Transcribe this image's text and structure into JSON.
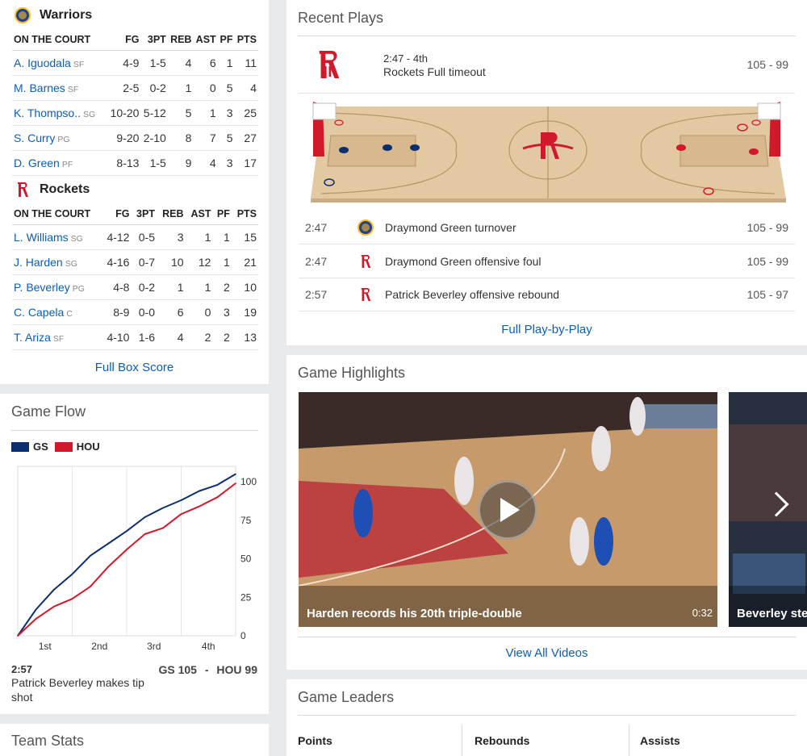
{
  "boxscore": {
    "warriors": {
      "name": "Warriors",
      "headers": [
        "ON THE COURT",
        "FG",
        "3PT",
        "REB",
        "AST",
        "PF",
        "PTS"
      ],
      "players": [
        {
          "name": "A. Iguodala",
          "pos": "SF",
          "fg": "4-9",
          "tp": "1-5",
          "reb": "4",
          "ast": "6",
          "pf": "1",
          "pts": "11"
        },
        {
          "name": "M. Barnes",
          "pos": "SF",
          "fg": "2-5",
          "tp": "0-2",
          "reb": "1",
          "ast": "0",
          "pf": "5",
          "pts": "4"
        },
        {
          "name": "K. Thompso..",
          "pos": "SG",
          "fg": "10-20",
          "tp": "5-12",
          "reb": "5",
          "ast": "1",
          "pf": "3",
          "pts": "25"
        },
        {
          "name": "S. Curry",
          "pos": "PG",
          "fg": "9-20",
          "tp": "2-10",
          "reb": "8",
          "ast": "7",
          "pf": "5",
          "pts": "27"
        },
        {
          "name": "D. Green",
          "pos": "PF",
          "fg": "8-13",
          "tp": "1-5",
          "reb": "9",
          "ast": "4",
          "pf": "3",
          "pts": "17"
        }
      ]
    },
    "rockets": {
      "name": "Rockets",
      "headers": [
        "ON THE COURT",
        "FG",
        "3PT",
        "REB",
        "AST",
        "PF",
        "PTS"
      ],
      "players": [
        {
          "name": "L. Williams",
          "pos": "SG",
          "fg": "4-12",
          "tp": "0-5",
          "reb": "3",
          "ast": "1",
          "pf": "1",
          "pts": "15"
        },
        {
          "name": "J. Harden",
          "pos": "SG",
          "fg": "4-16",
          "tp": "0-7",
          "reb": "10",
          "ast": "12",
          "pf": "1",
          "pts": "21"
        },
        {
          "name": "P. Beverley",
          "pos": "PG",
          "fg": "4-8",
          "tp": "0-2",
          "reb": "1",
          "ast": "1",
          "pf": "2",
          "pts": "10"
        },
        {
          "name": "C. Capela",
          "pos": "C",
          "fg": "8-9",
          "tp": "0-0",
          "reb": "6",
          "ast": "0",
          "pf": "3",
          "pts": "19"
        },
        {
          "name": "T. Ariza",
          "pos": "SF",
          "fg": "4-10",
          "tp": "1-6",
          "reb": "4",
          "ast": "2",
          "pf": "2",
          "pts": "13"
        }
      ]
    },
    "full_link": "Full Box Score"
  },
  "game_flow": {
    "title": "Game Flow",
    "legend": [
      {
        "label": "GS",
        "color": "#0b2e6e"
      },
      {
        "label": "HOU",
        "color": "#d1192b"
      }
    ],
    "ytick_labels": [
      "100",
      "75",
      "50",
      "25",
      "0"
    ],
    "xtick_labels": [
      "1st",
      "2nd",
      "3rd",
      "4th"
    ],
    "last_time": "2:57",
    "last_play": "Patrick Beverley makes tip shot",
    "score_gs": "GS 105",
    "sep": "-",
    "score_hou": "HOU 99"
  },
  "chart_data": {
    "type": "line",
    "title": "",
    "xlabel": "",
    "ylabel": "",
    "x": [
      0,
      4,
      8,
      12,
      16,
      20,
      24,
      28,
      32,
      36,
      40,
      44,
      48
    ],
    "xlim": [
      0,
      48
    ],
    "ylim": [
      0,
      110
    ],
    "series": [
      {
        "name": "GS",
        "color": "#0b2e6e",
        "values": [
          0,
          17,
          30,
          40,
          52,
          60,
          68,
          77,
          83,
          88,
          94,
          98,
          105
        ]
      },
      {
        "name": "HOU",
        "color": "#d1192b",
        "values": [
          0,
          11,
          19,
          24,
          32,
          45,
          56,
          66,
          70,
          79,
          84,
          90,
          99
        ]
      }
    ]
  },
  "team_stats": {
    "title": "Team Stats"
  },
  "recent_plays": {
    "title": "Recent Plays",
    "featured": {
      "time": "2:47 - 4th",
      "desc": "Rockets Full timeout",
      "score": "105 - 99"
    },
    "plays": [
      {
        "time": "2:47",
        "team": "gsw",
        "desc": "Draymond Green turnover",
        "score": "105 - 99"
      },
      {
        "time": "2:47",
        "team": "hou",
        "desc": "Draymond Green offensive foul",
        "score": "105 - 99"
      },
      {
        "time": "2:57",
        "team": "hou",
        "desc": "Patrick Beverley offensive rebound",
        "score": "105 - 97"
      }
    ],
    "full_link": "Full Play-by-Play",
    "colors": {
      "gs": "#0b2e6e",
      "hou": "#d1192b",
      "court": "#e3c9a1"
    }
  },
  "highlights": {
    "title": "Game Highlights",
    "videos": [
      {
        "title": "Harden records his 20th triple-double",
        "duration": "0:32"
      },
      {
        "title": "Beverley stea",
        "duration": ""
      }
    ],
    "view_all": "View All Videos"
  },
  "leaders": {
    "title": "Game Leaders",
    "tabs": [
      "Points",
      "Rebounds",
      "Assists"
    ]
  }
}
